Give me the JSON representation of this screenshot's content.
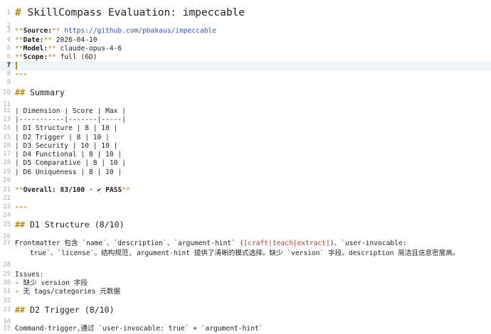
{
  "editor": {
    "lines": [
      {
        "n": "1",
        "kind": "h1",
        "text": "SkillCompass Evaluation: impeccable"
      },
      {
        "n": "2",
        "kind": "blank"
      },
      {
        "n": "3",
        "kind": "kv",
        "key": "Source:",
        "value": "https://github.com/pbakaus/impeccable",
        "link": true
      },
      {
        "n": "4",
        "kind": "kv",
        "key": "Date:",
        "value": "2026-04-10"
      },
      {
        "n": "5",
        "kind": "kv",
        "key": "Model:",
        "value": "claude-opus-4-6"
      },
      {
        "n": "6",
        "kind": "kv",
        "key": "Scope:",
        "value": "full (6D)"
      },
      {
        "n": "7",
        "kind": "blank",
        "current": true
      },
      {
        "n": "8",
        "kind": "hr",
        "text": "---"
      },
      {
        "n": "9",
        "kind": "blank"
      },
      {
        "n": "10",
        "kind": "h2",
        "text": "Summary"
      },
      {
        "n": "11",
        "kind": "blank"
      },
      {
        "n": "12",
        "kind": "text",
        "text": "| Dimension | Score | Max |"
      },
      {
        "n": "13",
        "kind": "text",
        "text": "|-----------|-------|-----|"
      },
      {
        "n": "14",
        "kind": "text",
        "text": "| D1 Structure | 8 | 10 |"
      },
      {
        "n": "15",
        "kind": "text",
        "text": "| D2 Trigger | 8 | 10 |"
      },
      {
        "n": "16",
        "kind": "text",
        "text": "| D3 Security | 10 | 10 |"
      },
      {
        "n": "17",
        "kind": "text",
        "text": "| D4 Functional | 8 | 10 |"
      },
      {
        "n": "18",
        "kind": "text",
        "text": "| D5 Comparative | 8 | 10 |"
      },
      {
        "n": "19",
        "kind": "text",
        "text": "| D6 Uniqueness | 8 | 10 |"
      },
      {
        "n": "20",
        "kind": "blank"
      },
      {
        "n": "21",
        "kind": "bold",
        "text": "Overall: 83/100 · ✔ PASS"
      },
      {
        "n": "22",
        "kind": "blank"
      },
      {
        "n": "23",
        "kind": "hr",
        "text": "---"
      },
      {
        "n": "24",
        "kind": "blank"
      },
      {
        "n": "25",
        "kind": "h2",
        "text": "D1 Structure (8/10)"
      },
      {
        "n": "26",
        "kind": "blank"
      },
      {
        "n": "27",
        "kind": "para",
        "pre": "Frontmatter 包含 `name`、`description`、`argument-hint` (",
        "red": "[craft|teach|extract]",
        "post": ")、`user-invocable:",
        "cont": "true`、`license`。结构规范, argument-hint 提供了清晰的模式选择。缺少 `version` 字段。description 简洁且信息密度高。"
      },
      {
        "n": "28",
        "kind": "blank"
      },
      {
        "n": "29",
        "kind": "text",
        "text": "Issues:"
      },
      {
        "n": "30",
        "kind": "li",
        "text": "缺少 version 字段"
      },
      {
        "n": "31",
        "kind": "li",
        "text": "无 tags/categories 元数据"
      },
      {
        "n": "32",
        "kind": "blank"
      },
      {
        "n": "33",
        "kind": "h2",
        "text": "D2 Trigger (8/10)"
      },
      {
        "n": "34",
        "kind": "blank"
      },
      {
        "n": "35",
        "kind": "text",
        "text": "Command-trigger,通过 `user-invocable: true` + `argument-hint`"
      }
    ]
  }
}
